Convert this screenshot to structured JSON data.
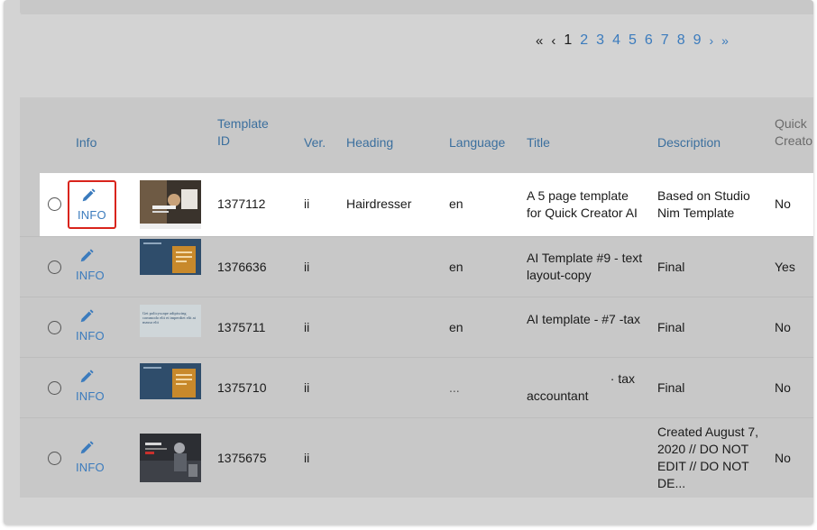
{
  "pagination": {
    "first": "«",
    "prev": "‹",
    "pages": [
      "1",
      "2",
      "3",
      "4",
      "5",
      "6",
      "7",
      "8",
      "9"
    ],
    "current": "1",
    "next": "›",
    "last": "»"
  },
  "table": {
    "columns": {
      "info": "Info",
      "template_id_line1": "Template",
      "template_id_line2": "ID",
      "ver": "Ver.",
      "heading": "Heading",
      "language": "Language",
      "title": "Title",
      "description": "Description",
      "quick_line1": "Quick",
      "quick_line2": "Creato"
    },
    "info_label": "INFO",
    "rows": [
      {
        "template_id": "1377112",
        "ver": "ii",
        "heading": "Hairdresser",
        "language": "en",
        "title_line1": "A 5 page template",
        "title_line2": "for Quick Creator AI",
        "desc_line1": "Based on Studio",
        "desc_line2": "Nim Template",
        "quick": "No"
      },
      {
        "template_id": "1376636",
        "ver": "ii",
        "heading": "",
        "language": "en",
        "title_line1": "AI Template #9 - text",
        "title_line2": "layout-copy",
        "desc_line1": "Final",
        "quick": "Yes"
      },
      {
        "template_id": "1375711",
        "ver": "ii",
        "heading": "",
        "language": "en",
        "title_line1": "AI template - #7 -tax",
        "desc_line1": "Final",
        "quick": "No",
        "thumb_text": "Get policyscape adipiscing commodo elit et imperdiet elit at massa elit"
      },
      {
        "template_id": "1375710",
        "ver": "ii",
        "heading": "",
        "language": "...",
        "title_line1": "· tax",
        "title_line2": "accountant",
        "desc_line1": "Final",
        "quick": "No"
      },
      {
        "template_id": "1375675",
        "ver": "ii",
        "heading": "",
        "language": "",
        "desc_line1": "Created August 7,",
        "desc_line2": "2020 // DO NOT",
        "desc_line3": "EDIT // DO NOT",
        "desc_line4": "DE...",
        "quick": "No"
      }
    ]
  },
  "colors": {
    "link": "#3b7bbd",
    "header_text": "#3b6f9e",
    "highlight_border": "#d9241b",
    "overlay": "#d3d3d3"
  },
  "icons": {
    "edit": "pencil-icon"
  }
}
